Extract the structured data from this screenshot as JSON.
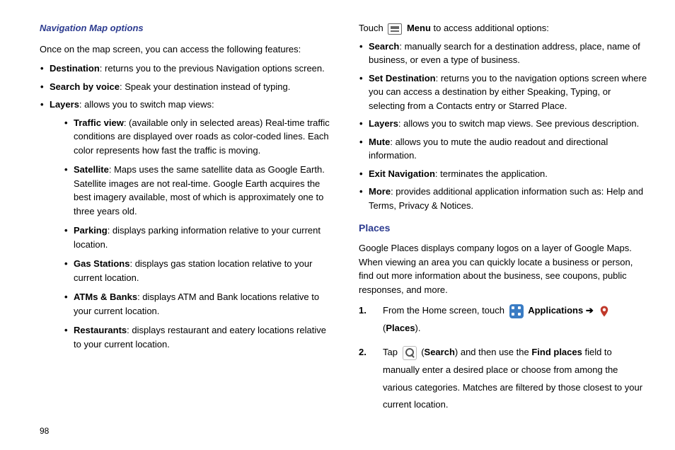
{
  "left": {
    "heading": "Navigation Map options",
    "intro": "Once on the map screen, you can access the following features:",
    "items": [
      {
        "term": "Destination",
        "desc": ": returns you to the previous Navigation options screen."
      },
      {
        "term": "Search by voice",
        "desc": ": Speak your destination instead of typing."
      },
      {
        "term": "Layers",
        "desc": ": allows you to switch map views:"
      }
    ],
    "layersSub": [
      {
        "term": "Traffic view",
        "desc": ": (available only in selected areas) Real-time traffic conditions are displayed over roads as color-coded lines. Each color represents how fast the traffic is moving."
      },
      {
        "term": "Satellite",
        "desc": ": Maps uses the same satellite data as Google Earth. Satellite images are not real-time. Google Earth acquires the best imagery available, most of which is approximately one to three years old."
      },
      {
        "term": "Parking",
        "desc": ": displays parking information relative to your current location."
      },
      {
        "term": "Gas Stations",
        "desc": ": displays gas station location relative to your current location."
      },
      {
        "term": "ATMs & Banks",
        "desc": ": displays ATM and Bank locations relative to your current location."
      },
      {
        "term": "Restaurants",
        "desc": ": displays restaurant and eatery locations relative to your current location."
      }
    ]
  },
  "right": {
    "menuLine": {
      "prefix": "Touch ",
      "menuWord": "Menu",
      "suffix": " to access additional options:"
    },
    "menuItems": [
      {
        "term": "Search",
        "desc": ": manually search for a destination address, place, name of business, or even a type of business."
      },
      {
        "term": "Set Destination",
        "desc": ": returns you to the navigation options screen where you can access a destination by either Speaking, Typing, or selecting from a Contacts entry or Starred Place."
      },
      {
        "term": "Layers",
        "desc": ": allows you to switch map views. See previous description."
      },
      {
        "term": "Mute",
        "desc": ": allows you to mute the audio readout and directional information."
      },
      {
        "term": "Exit Navigation",
        "desc": ": terminates the application."
      },
      {
        "term": "More",
        "desc": ": provides additional application information such as: Help and Terms, Privacy & Notices."
      }
    ],
    "placesHeading": "Places",
    "placesIntro": "Google Places displays company logos on a layer of Google Maps. When viewing an area you can quickly locate a business or person, find out more information about the business, see coupons, public responses, and more.",
    "step1": {
      "num": "1.",
      "prefix": "From the Home screen, touch ",
      "apps": "Applications",
      "arrow": "➔",
      "places": "Places",
      "close": "."
    },
    "step2": {
      "num": "2.",
      "prefix": "Tap ",
      "search": "Search",
      "mid": ") and then use the ",
      "find": "Find places",
      "suffix": " field to manually enter a desired place or choose from among the various categories. Matches are filtered by those closest to your current location."
    }
  },
  "pageNumber": "98"
}
